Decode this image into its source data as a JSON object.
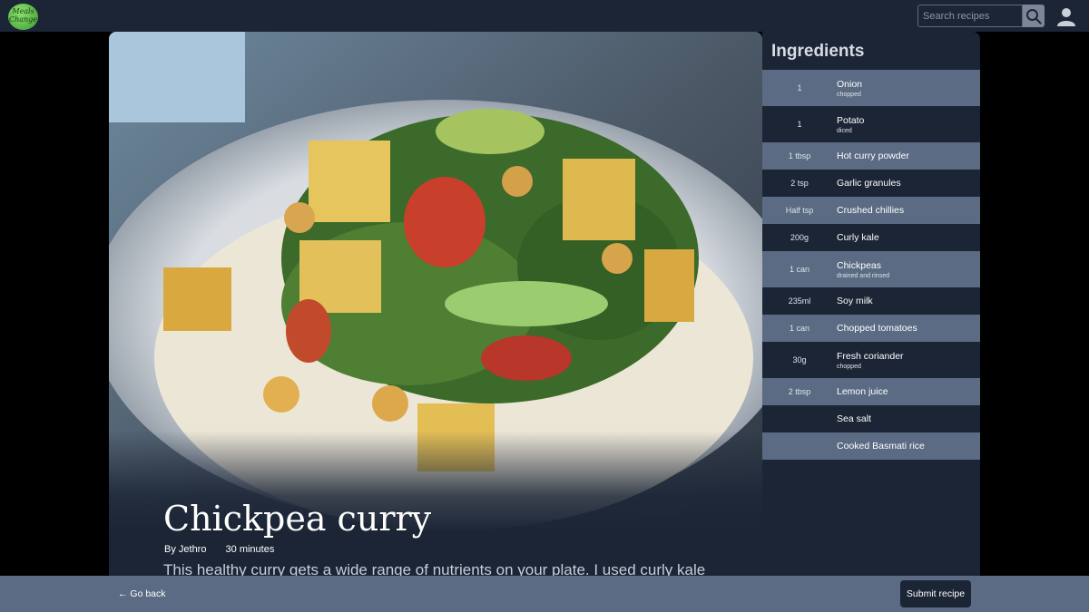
{
  "header": {
    "logo_text": "Meals Change",
    "search_placeholder": "Search recipes"
  },
  "recipe": {
    "title": "Chickpea curry",
    "author": "By Jethro",
    "duration": "30 minutes",
    "description": "This healthy curry gets a wide range of nutrients on your plate. I used curly kale"
  },
  "ingredients": {
    "heading": "Ingredients",
    "items": [
      {
        "qty": "1",
        "name": "Onion",
        "note": "chopped"
      },
      {
        "qty": "1",
        "name": "Potato",
        "note": "diced"
      },
      {
        "qty": "1 tbsp",
        "name": "Hot curry powder",
        "note": ""
      },
      {
        "qty": "2 tsp",
        "name": "Garlic granules",
        "note": ""
      },
      {
        "qty": "Half tsp",
        "name": "Crushed chillies",
        "note": ""
      },
      {
        "qty": "200g",
        "name": "Curly kale",
        "note": ""
      },
      {
        "qty": "1 can",
        "name": "Chickpeas",
        "note": "drained and rinsed"
      },
      {
        "qty": "235ml",
        "name": "Soy milk",
        "note": ""
      },
      {
        "qty": "1 can",
        "name": "Chopped tomatoes",
        "note": ""
      },
      {
        "qty": "30g",
        "name": "Fresh coriander",
        "note": "chopped"
      },
      {
        "qty": "2 tbsp",
        "name": "Lemon juice",
        "note": ""
      },
      {
        "qty": "",
        "name": "Sea salt",
        "note": ""
      },
      {
        "qty": "",
        "name": "Cooked Basmati rice",
        "note": ""
      }
    ]
  },
  "footer": {
    "back_label": "← Go back",
    "submit_label": "Submit recipe"
  }
}
